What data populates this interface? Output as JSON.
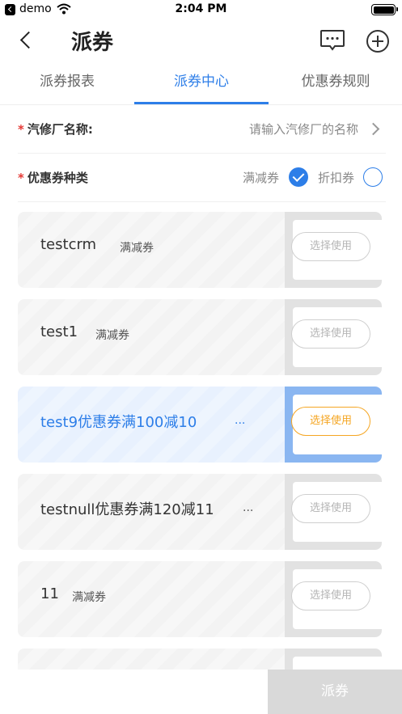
{
  "status_bar": {
    "app": "demo",
    "time": "2:04 PM"
  },
  "nav": {
    "title": "派券"
  },
  "tabs": [
    {
      "label": "派券报表",
      "active": false
    },
    {
      "label": "派券中心",
      "active": true
    },
    {
      "label": "优惠券规则",
      "active": false
    }
  ],
  "form": {
    "shop": {
      "required_mark": "*",
      "label": "汽修厂名称:",
      "placeholder": "请输入汽修厂的名称"
    },
    "coupon_kind": {
      "required_mark": "*",
      "label": "优惠券种类",
      "options": [
        {
          "label": "满减券",
          "checked": true
        },
        {
          "label": "折扣券",
          "checked": false
        }
      ]
    }
  },
  "coupons": [
    {
      "name": "testcrm",
      "type": "满减券",
      "button": "选择使用",
      "selected": false
    },
    {
      "name": "test1",
      "type": "满减券",
      "button": "选择使用",
      "selected": false
    },
    {
      "name": "test9优惠券满100减10",
      "type": "...",
      "button": "选择使用",
      "selected": true
    },
    {
      "name": "testnull优惠券满120减11",
      "type": "...",
      "button": "选择使用",
      "selected": false
    },
    {
      "name": "11",
      "type": "满减券",
      "button": "选择使用",
      "selected": false
    },
    {
      "name": "",
      "type": "",
      "button": "",
      "selected": false
    }
  ],
  "submit": {
    "label": "派券"
  },
  "colors": {
    "accent": "#2d7ee8",
    "required": "#e53935",
    "selected_button": "#f5a623"
  }
}
